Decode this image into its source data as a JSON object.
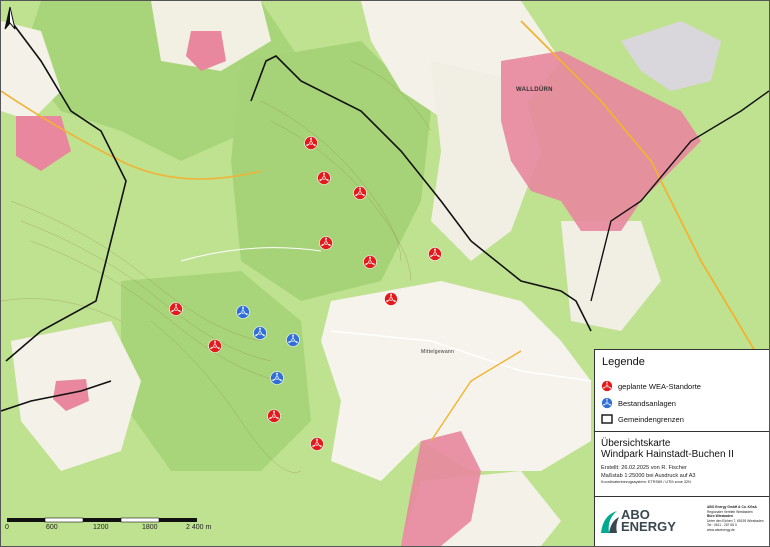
{
  "legend": {
    "title": "Legende",
    "planned_label": "geplante WEA-Standorte",
    "existing_label": "Bestandsanlagen",
    "boundary_label": "Gemeindengrenzen"
  },
  "info": {
    "title_line1": "Übersichtskarte",
    "title_line2": "Windpark Hainstadt-Buchen II",
    "created": "Erstellt: 26.02.2025 von R. Fischer",
    "scale": "Maßstab 1:25000  bei Ausdruck auf A3",
    "crs": "Koordinatenbezugssystem: ETRS89 / UTM zone 32N"
  },
  "logo": {
    "brand_line1": "ABO",
    "brand_line2": "ENERGY",
    "company_lines": [
      "ABO Energy GmbH & Co. KGaA",
      "Regionaler Vertrieb Westbaden",
      "Büro Wiesbaden",
      "Unter den Eichen 7, 65195 Wiesbaden",
      "Tel.: 0611 - 267 65 0",
      "www.aboenergy.de"
    ]
  },
  "scale_bar": {
    "ticks": [
      "0",
      "600",
      "1200",
      "1800",
      "2 400 m"
    ]
  },
  "places": {
    "town": "WALLDÜRN",
    "field": "Mittelgewann"
  },
  "colors": {
    "planned": "#e31a1c",
    "existing": "#2f6fd6",
    "forest": "#b5dc86",
    "field": "#f7f4ee",
    "settlement": "#e8879e"
  },
  "turbines_planned_count": 12,
  "turbines_existing_count": 4
}
